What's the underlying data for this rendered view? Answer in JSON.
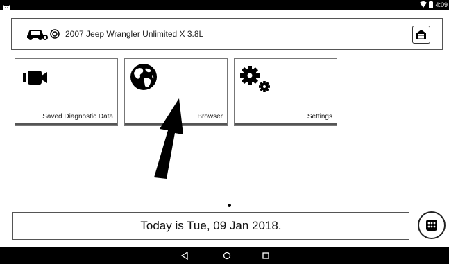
{
  "status_bar": {
    "time": "4:09",
    "icons": [
      "cat-icon",
      "wifi-icon",
      "battery-icon"
    ]
  },
  "vehicle": {
    "name": "2007 Jeep Wrangler Unlimited X 3.8L",
    "icons": [
      "car-icon",
      "ring-icon",
      "garage-icon"
    ]
  },
  "tiles": [
    {
      "label": "Saved Diagnostic Data",
      "icon": "video-camera-icon"
    },
    {
      "label": "Browser",
      "icon": "globe-icon"
    },
    {
      "label": "Settings",
      "icon": "gears-icon"
    }
  ],
  "footer": {
    "date_text": "Today is Tue, 09 Jan 2018."
  },
  "nav_bar": {
    "buttons": [
      "back-icon",
      "home-icon",
      "recents-icon"
    ]
  },
  "colors": {
    "frame": "#555555",
    "text": "#222222",
    "bars": "#000000"
  }
}
